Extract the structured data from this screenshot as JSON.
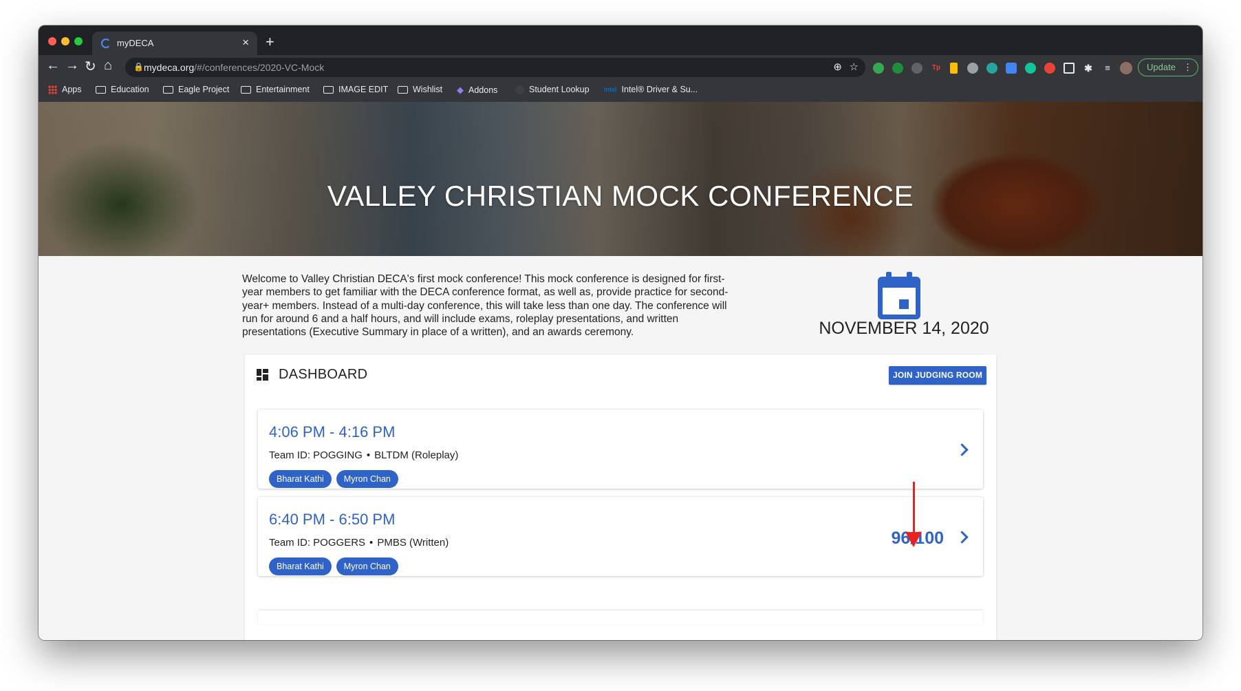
{
  "browser": {
    "tab_title": "myDECA",
    "tab_close": "×",
    "new_tab": "+",
    "url_host": "mydeca.org",
    "url_path": "/#/conferences/2020-VC-Mock",
    "update_label": "Update"
  },
  "bookmarks": [
    {
      "label": "Apps",
      "icon": "apps-grid-icon"
    },
    {
      "label": "Education",
      "icon": "folder-icon"
    },
    {
      "label": "Eagle Project",
      "icon": "folder-icon"
    },
    {
      "label": "Entertainment",
      "icon": "folder-icon"
    },
    {
      "label": "IMAGE EDIT",
      "icon": "folder-icon"
    },
    {
      "label": "Wishlist",
      "icon": "folder-icon"
    },
    {
      "label": "Addons",
      "icon": "addons-icon"
    },
    {
      "label": "Student Lookup",
      "icon": "globe-icon"
    },
    {
      "label": "Intel® Driver & Su...",
      "icon": "intel-icon"
    }
  ],
  "hero": {
    "title": "VALLEY CHRISTIAN MOCK CONFERENCE"
  },
  "intro": {
    "text": "Welcome to Valley Christian DECA's first mock conference! This mock conference is designed for first-year members to get familiar with the DECA conference format, as well as, provide practice for second-year+ members. Instead of a multi-day conference, this will take less than one day. The conference will run for around 6 and a half hours, and will include exams, roleplay presentations, and written presentations (Executive Summary in place of a written), and an awards ceremony."
  },
  "event_date": "NOVEMBER 14, 2020",
  "dashboard": {
    "title": "DASHBOARD",
    "join_button": "JOIN JUDGING ROOM",
    "cards": [
      {
        "time": "4:06 PM - 4:16 PM",
        "team": "Team ID: POGGING",
        "event": "BLTDM (Roleplay)",
        "members": [
          "Bharat Kathi",
          "Myron Chan"
        ],
        "score": ""
      },
      {
        "time": "6:40 PM - 6:50 PM",
        "team": "Team ID: POGGERS",
        "event": "PMBS (Written)",
        "members": [
          "Bharat Kathi",
          "Myron Chan"
        ],
        "score": "96/100"
      }
    ],
    "separator": "•"
  },
  "colors": {
    "accent": "#2f63c7",
    "annotation_arrow": "#e82222",
    "update_green": "#81c995"
  }
}
